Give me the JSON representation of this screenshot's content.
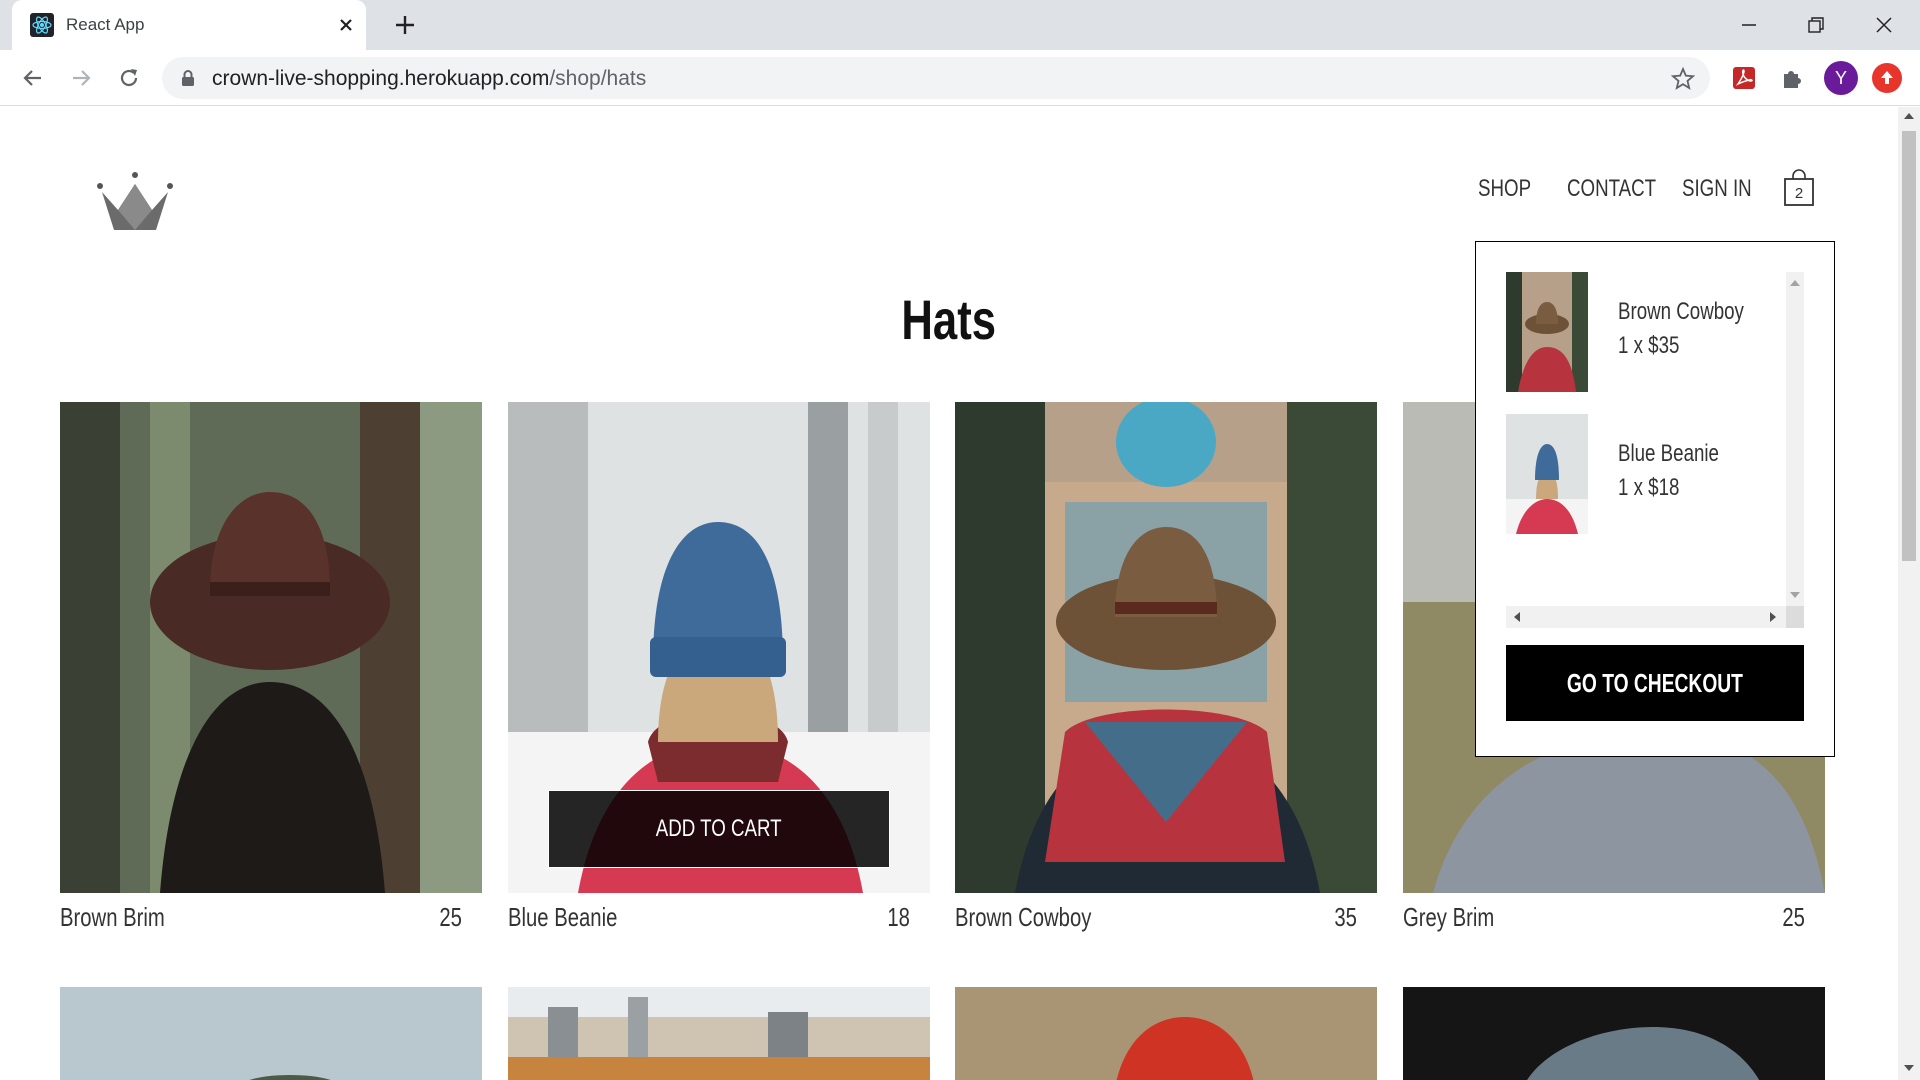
{
  "browser": {
    "tab_title": "React App",
    "url_host": "crown-live-shopping.herokuapp.com",
    "url_path": "/shop/hats",
    "profile_initial": "Y"
  },
  "header": {
    "nav": [
      {
        "label": "SHOP"
      },
      {
        "label": "CONTACT"
      },
      {
        "label": "SIGN IN"
      }
    ],
    "cart_count": "2"
  },
  "page": {
    "title": "Hats",
    "items": [
      {
        "name": "Brown Brim",
        "price": "25"
      },
      {
        "name": "Blue Beanie",
        "price": "18"
      },
      {
        "name": "Brown Cowboy",
        "price": "35"
      },
      {
        "name": "Grey Brim",
        "price": "25"
      }
    ],
    "hover_button_label": "ADD TO CART"
  },
  "cart_dropdown": {
    "items": [
      {
        "name": "Brown Cowboy",
        "qty_price": "1 x $35"
      },
      {
        "name": "Blue Beanie",
        "qty_price": "1 x $18"
      }
    ],
    "checkout_label": "GO TO CHECKOUT"
  },
  "colors": {
    "accent_black": "#000000",
    "text": "#333333",
    "chrome_bg": "#dee1e6",
    "profile": "#6a1b9a"
  }
}
